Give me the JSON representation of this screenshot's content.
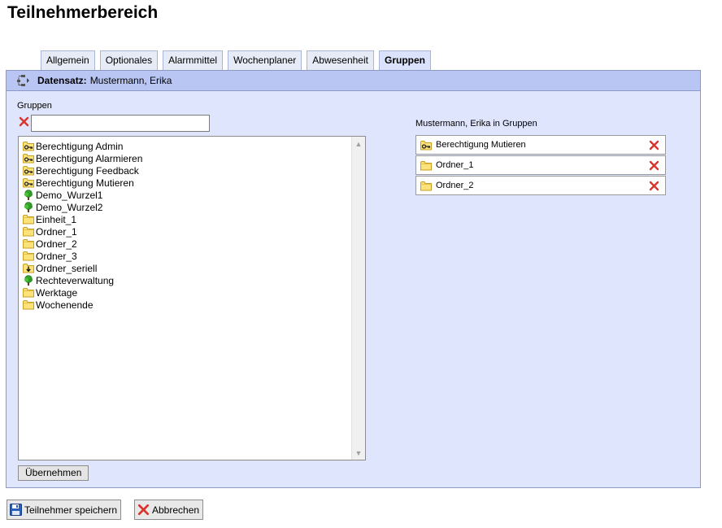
{
  "page_title": "Teilnehmerbereich",
  "tabs": [
    {
      "label": "Allgemein",
      "active": false
    },
    {
      "label": "Optionales",
      "active": false
    },
    {
      "label": "Alarmmittel",
      "active": false
    },
    {
      "label": "Wochenplaner",
      "active": false
    },
    {
      "label": "Abwesenheit",
      "active": false
    },
    {
      "label": "Gruppen",
      "active": true
    }
  ],
  "header": {
    "label": "Datensatz:",
    "value": "Mustermann, Erika"
  },
  "left": {
    "label": "Gruppen",
    "search_value": "",
    "items": [
      {
        "label": "Berechtigung Admin",
        "icon": "key-icon"
      },
      {
        "label": "Berechtigung Alarmieren",
        "icon": "key-icon"
      },
      {
        "label": "Berechtigung Feedback",
        "icon": "key-icon"
      },
      {
        "label": "Berechtigung Mutieren",
        "icon": "key-icon"
      },
      {
        "label": "Demo_Wurzel1",
        "icon": "tree-icon"
      },
      {
        "label": "Demo_Wurzel2",
        "icon": "tree-icon"
      },
      {
        "label": "Einheit_1",
        "icon": "folder-icon"
      },
      {
        "label": "Ordner_1",
        "icon": "folder-icon"
      },
      {
        "label": "Ordner_2",
        "icon": "folder-icon"
      },
      {
        "label": "Ordner_3",
        "icon": "folder-icon"
      },
      {
        "label": "Ordner_seriell",
        "icon": "serial-folder-icon"
      },
      {
        "label": "Rechteverwaltung",
        "icon": "tree-icon"
      },
      {
        "label": "Werktage",
        "icon": "folder-icon"
      },
      {
        "label": "Wochenende",
        "icon": "folder-icon"
      }
    ],
    "apply_button": "Übernehmen"
  },
  "right": {
    "label": "Mustermann, Erika in Gruppen",
    "items": [
      {
        "label": "Berechtigung Mutieren",
        "icon": "key-icon"
      },
      {
        "label": "Ordner_1",
        "icon": "folder-icon"
      },
      {
        "label": "Ordner_2",
        "icon": "folder-icon"
      }
    ]
  },
  "footer": {
    "save_label": "Teilnehmer speichern",
    "cancel_label": "Abbrechen"
  },
  "colors": {
    "panel_bg": "#dfe5fd",
    "header_bg": "#b9c6f3",
    "delete_red": "#d9342b"
  }
}
